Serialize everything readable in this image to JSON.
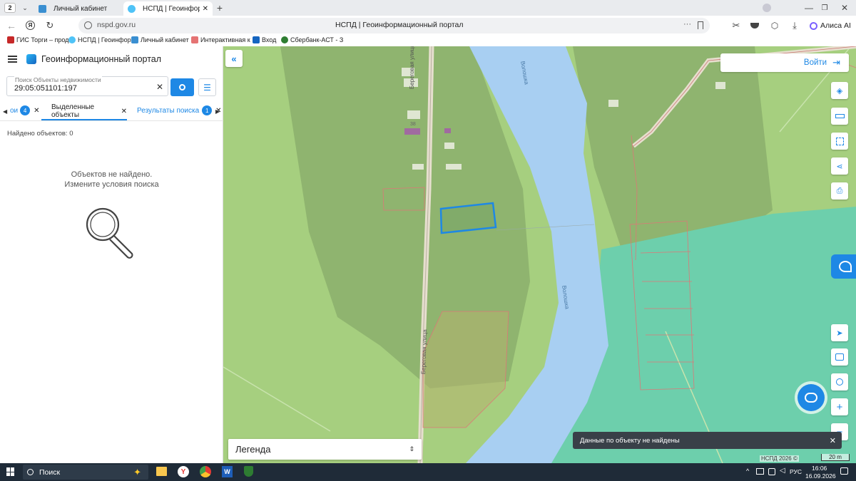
{
  "browser": {
    "tab_count": "2",
    "tabs": [
      {
        "title": "Личный кабинет"
      },
      {
        "title": "НСПД | Геоинформацио"
      }
    ],
    "url": "nspd.gov.ru",
    "page_title": "НСПД | Геоинформационный портал",
    "alice_label": "Алиса AI",
    "bookmarks": [
      {
        "label": "ГИС Торги – прод"
      },
      {
        "label": "НСПД | Геоинфор"
      },
      {
        "label": "Личный кабинет"
      },
      {
        "label": "Интерактивная к"
      },
      {
        "label": "Вход"
      },
      {
        "label": "Сбербанк-АСТ - З"
      }
    ]
  },
  "app": {
    "title": "Геоинформационный портал",
    "search": {
      "label": "Поиск Объекты недвижимости",
      "value": "29:05:051101:197"
    },
    "tabs": [
      {
        "label": "ои",
        "badge": "4"
      },
      {
        "label": "Выделенные объекты",
        "active": true
      },
      {
        "label": "Результаты поиска",
        "badge": "1"
      }
    ],
    "found_count": "Найдено объектов: 0",
    "empty_line1": "Объектов не найдено.",
    "empty_line2": "Измените условия поиска"
  },
  "map": {
    "login_label": "Войти",
    "legend_label": "Легенда",
    "toast": "Данные по объекту не найдены",
    "copyright": "НСПД 2026 ©",
    "scale": "20 m",
    "street_labels": [
      "Береговая улица",
      "Береговая улица"
    ],
    "river_labels": [
      "Волошка",
      "Волошка"
    ],
    "house_number": "38",
    "colors": {
      "land": "#a6cf7f",
      "forest": "#8fb46f",
      "water": "#a8cff2",
      "zone": "#6dcfac",
      "parcel_highlight": "#1e88e5"
    }
  },
  "taskbar": {
    "search_label": "Поиск",
    "lang": "РУС",
    "time": "16:06",
    "date": "16.09.2026"
  }
}
